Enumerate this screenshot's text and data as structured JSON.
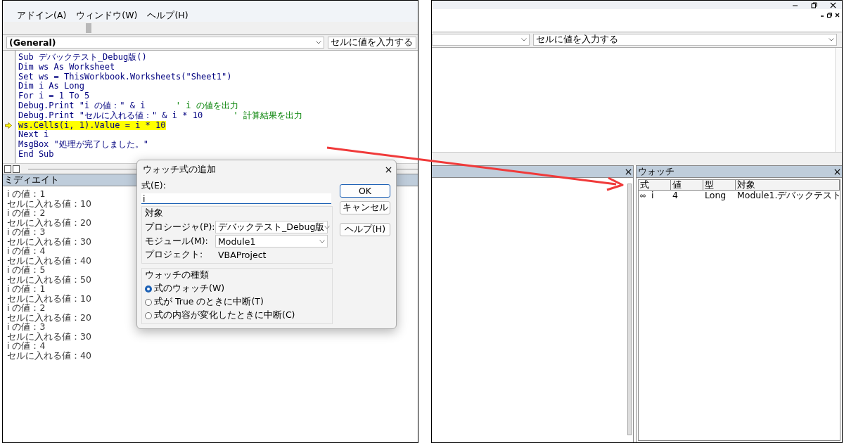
{
  "left_window": {
    "menu": [
      "アドイン(A)",
      "ウィンドウ(W)",
      "ヘルプ(H)"
    ],
    "object_combo": "(General)",
    "procedure_combo": "セルに値を入力する",
    "code_lines": [
      {
        "code": "Sub デバックテスト_Debug版()",
        "current": false
      },
      {
        "code": "Dim ws As Worksheet",
        "current": false
      },
      {
        "code": "Set ws = ThisWorkbook.Worksheets(\"Sheet1\")",
        "current": false
      },
      {
        "code": "Dim i As Long",
        "current": false
      },
      {
        "code": "For i = 1 To 5",
        "current": false
      },
      {
        "code": "Debug.Print \"i の値：\" & i",
        "comment": "' i の値を出力",
        "current": false
      },
      {
        "code": "Debug.Print \"セルに入れる値：\" & i * 10",
        "comment": "' 計算結果を出力",
        "current": false
      },
      {
        "code": "ws.Cells(i, 1).Value = i * 10",
        "current": true
      },
      {
        "code": "Next i",
        "current": false
      },
      {
        "code": "MsgBox \"処理が完了しました。\"",
        "current": false
      },
      {
        "code": "End Sub",
        "current": false
      }
    ],
    "immediate": {
      "title": "ミディエイト",
      "lines": [
        "i の値：1",
        "セルに入れる値：10",
        "i の値：2",
        "セルに入れる値：20",
        "i の値：3",
        "セルに入れる値：30",
        "i の値：4",
        "セルに入れる値：40",
        "i の値：5",
        "セルに入れる値：50",
        "i の値：1",
        "セルに入れる値：10",
        "i の値：2",
        "セルに入れる値：20",
        "i の値：3",
        "セルに入れる値：30",
        "i の値：4",
        "セルに入れる値：40"
      ]
    }
  },
  "dialog": {
    "title": "ウォッチ式の追加",
    "expression_label": "式(E):",
    "expression_value": "i",
    "context_label": "対象",
    "fields": [
      {
        "label": "プロシージャ(P):",
        "value": "デバックテスト_Debug版",
        "kind": "combo"
      },
      {
        "label": "モジュール(M):",
        "value": "Module1",
        "kind": "combo"
      },
      {
        "label": "プロジェクト:",
        "value": "VBAProject",
        "kind": "text"
      }
    ],
    "watch_type_label": "ウォッチの種類",
    "options": [
      {
        "label": "式のウォッチ(W)",
        "selected": true
      },
      {
        "label": "式が True のときに中断(T)",
        "selected": false
      },
      {
        "label": "式の内容が変化したときに中断(C)",
        "selected": false
      }
    ],
    "buttons": [
      {
        "label": "OK",
        "default": true
      },
      {
        "label": "キャンセル",
        "default": false
      },
      {
        "label": "ヘルプ(H)",
        "default": false
      }
    ]
  },
  "right_window": {
    "procedure_combo": "セルに値を入力する",
    "watch_pane": {
      "title": "ウォッチ",
      "columns": [
        "式",
        "値",
        "型",
        "対象"
      ],
      "rows": [
        {
          "expression": "i",
          "value": "4",
          "type": "Long",
          "context": "Module1.デバックテスト"
        }
      ]
    }
  }
}
